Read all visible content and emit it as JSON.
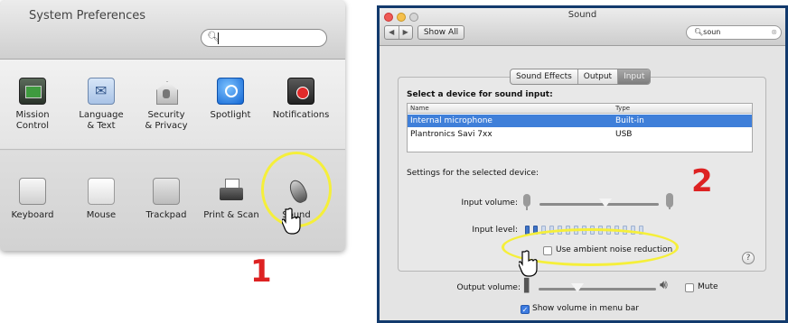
{
  "system_preferences": {
    "title": "System Preferences",
    "search": {
      "value": "",
      "icon": "magnifier-icon"
    },
    "row1": [
      {
        "label": "Mission\nControl",
        "icon": "mission-control-icon"
      },
      {
        "label": "Language\n& Text",
        "icon": "language-text-icon"
      },
      {
        "label": "Security\n& Privacy",
        "icon": "security-privacy-icon"
      },
      {
        "label": "Spotlight",
        "icon": "spotlight-icon"
      },
      {
        "label": "Notifications",
        "icon": "notifications-icon"
      }
    ],
    "row2": [
      {
        "label": "Keyboard",
        "icon": "keyboard-icon"
      },
      {
        "label": "Mouse",
        "icon": "mouse-icon"
      },
      {
        "label": "Trackpad",
        "icon": "trackpad-icon"
      },
      {
        "label": "Print & Scan",
        "icon": "printer-icon"
      },
      {
        "label": "Sound",
        "icon": "sound-icon"
      }
    ],
    "step_number": "1"
  },
  "sound": {
    "title": "Sound",
    "show_all": "Show All",
    "search_value": "soun",
    "tabs": [
      "Sound Effects",
      "Output",
      "Input"
    ],
    "active_tab": "Input",
    "select_label": "Select a device for sound input:",
    "table": {
      "headers": [
        "Name",
        "Type"
      ],
      "rows": [
        {
          "name": "Internal microphone",
          "type": "Built-in",
          "selected": true
        },
        {
          "name": "Plantronics Savi 7xx",
          "type": "USB",
          "selected": false
        }
      ]
    },
    "settings_label": "Settings for the selected device:",
    "input_volume_label": "Input volume:",
    "input_level_label": "Input level:",
    "input_volume_level": 0.55,
    "input_level_on_bars": 2,
    "input_level_total_bars": 15,
    "noise_reduction_label": "Use ambient noise reduction",
    "noise_reduction_checked": false,
    "help_glyph": "?",
    "output_volume_label": "Output volume:",
    "output_volume_level": 0.33,
    "mute_label": "Mute",
    "mute_checked": false,
    "show_volume_label": "Show volume in menu bar",
    "show_volume_checked": true,
    "step_number": "2"
  },
  "annotations": {
    "highlight_color": "#f5ef3a",
    "step_color": "#dd2222"
  }
}
